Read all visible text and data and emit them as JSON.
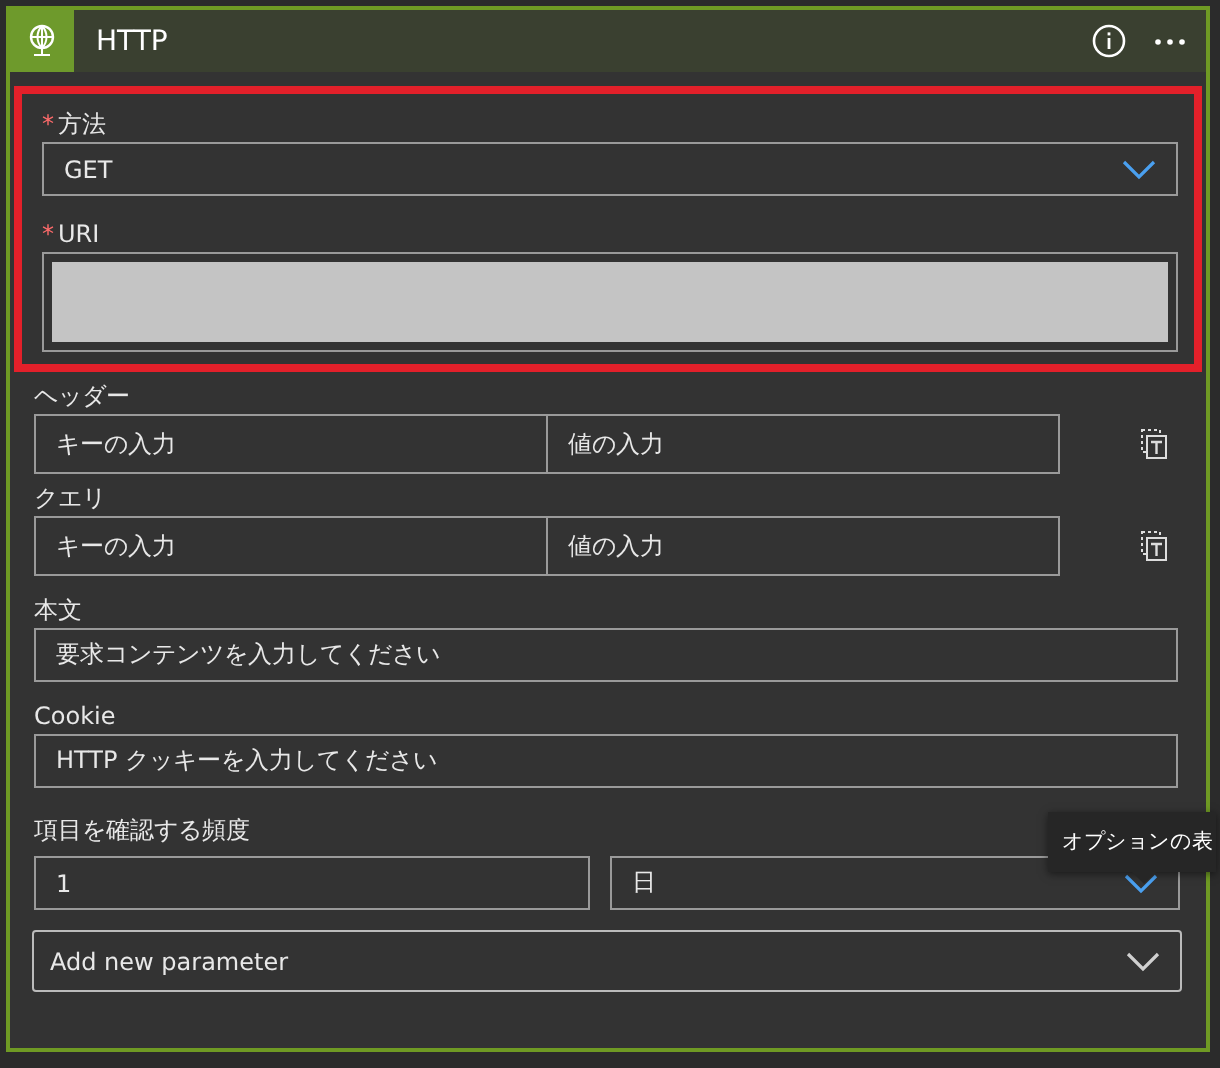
{
  "header": {
    "title": "HTTP"
  },
  "highlighted_fields": [
    {
      "kind": "dropdown",
      "label": "方法",
      "required_mark": "*",
      "value": "GET"
    },
    {
      "kind": "redacted",
      "label": "URI",
      "required_mark": "*"
    }
  ],
  "fields": [
    {
      "kind": "keyvalue",
      "label": "ヘッダー",
      "key_placeholder": "キーの入力",
      "value_placeholder": "値の入力"
    },
    {
      "kind": "keyvalue",
      "label": "クエリ",
      "key_placeholder": "キーの入力",
      "value_placeholder": "値の入力"
    },
    {
      "kind": "text",
      "label": "本文",
      "placeholder": "要求コンテンツを入力してください"
    },
    {
      "kind": "text",
      "label": "Cookie",
      "placeholder": "HTTP クッキーを入力してください"
    },
    {
      "kind": "frequency",
      "label": "項目を確認する頻度",
      "interval": "1",
      "unit": "日"
    }
  ],
  "add_parameter": {
    "label": "Add new parameter"
  },
  "tooltip": {
    "text": "オプションの表"
  }
}
